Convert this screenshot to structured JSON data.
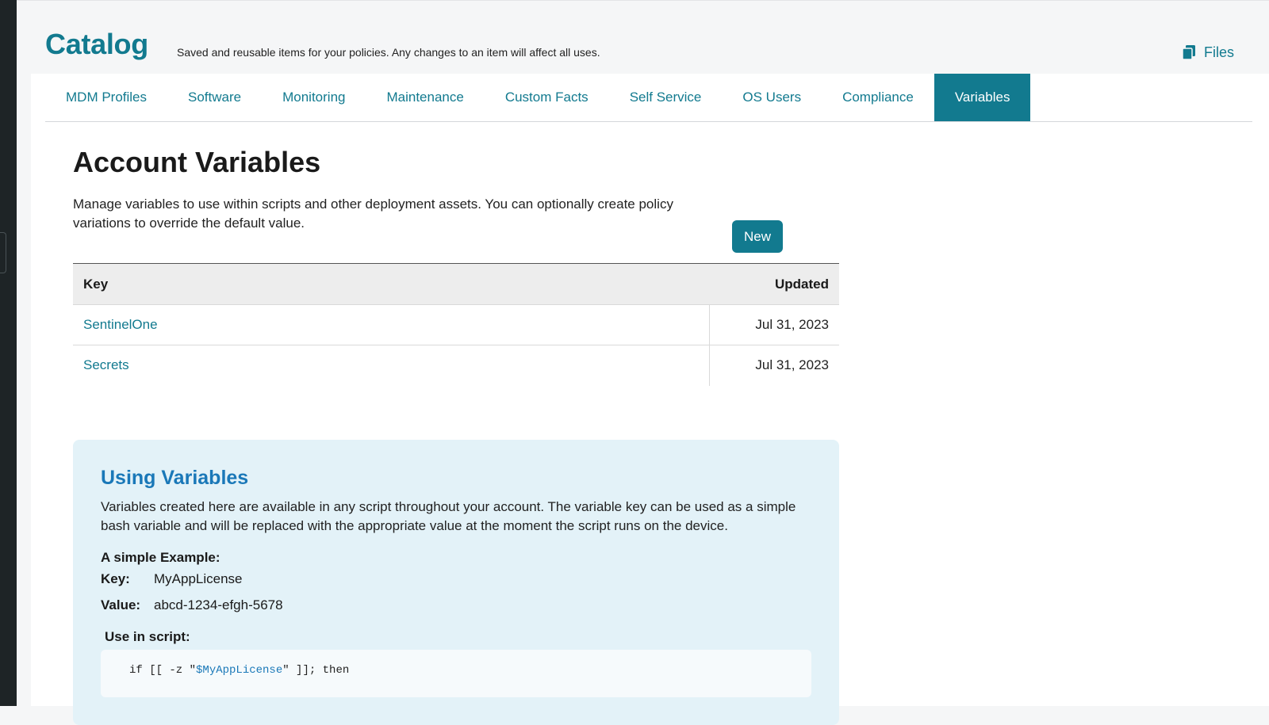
{
  "header": {
    "title": "Catalog",
    "subtitle": "Saved and reusable items for your policies. Any changes to an item will affect all uses.",
    "files_label": "Files"
  },
  "tabs": [
    {
      "label": "MDM Profiles",
      "active": false
    },
    {
      "label": "Software",
      "active": false
    },
    {
      "label": "Monitoring",
      "active": false
    },
    {
      "label": "Maintenance",
      "active": false
    },
    {
      "label": "Custom Facts",
      "active": false
    },
    {
      "label": "Self Service",
      "active": false
    },
    {
      "label": "OS Users",
      "active": false
    },
    {
      "label": "Compliance",
      "active": false
    },
    {
      "label": "Variables",
      "active": true
    }
  ],
  "page": {
    "title": "Account Variables",
    "description": "Manage variables to use within scripts and other deployment assets. You can optionally create policy variations to override the default value.",
    "new_label": "New"
  },
  "table": {
    "columns": {
      "key": "Key",
      "updated": "Updated"
    },
    "rows": [
      {
        "key": "SentinelOne",
        "updated": "Jul 31, 2023"
      },
      {
        "key": "Secrets",
        "updated": "Jul 31, 2023"
      }
    ]
  },
  "info": {
    "title": "Using Variables",
    "text": "Variables created here are available in any script throughout your account. The variable key can be used as a simple bash variable and will be replaced with the appropriate value at the moment the script runs on the device.",
    "example_label": "A simple Example:",
    "key_label": "Key:",
    "key_value": "MyAppLicense",
    "value_label": "Value:",
    "value_value": "abcd-1234-efgh-5678",
    "use_label": "Use in script:",
    "code_prefix": "if [[ -z \"",
    "code_var": "$MyAppLicense",
    "code_suffix": "\" ]]; then"
  },
  "colors": {
    "accent": "#127a8f",
    "info_bg": "#e3f2f8",
    "info_title": "#1a78b8"
  }
}
